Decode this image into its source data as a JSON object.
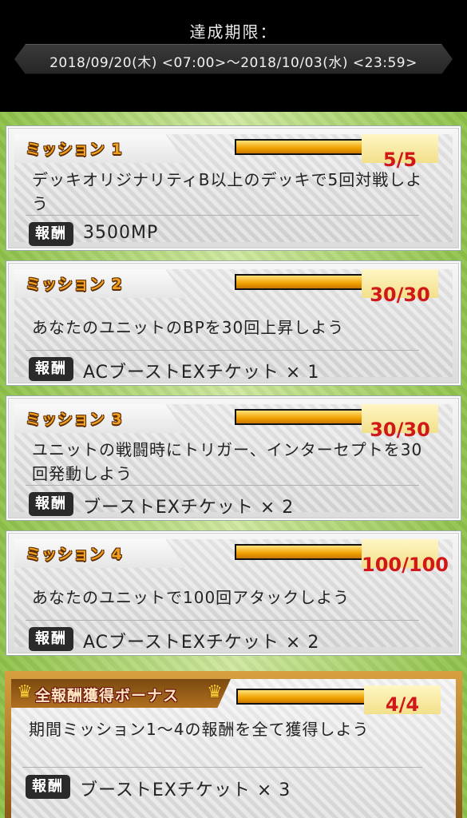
{
  "header": {
    "period_label": "達成期限：",
    "period_range": "2018/09/20(木) <07:00>〜2018/10/03(水) <23:59>"
  },
  "reward_label": "報酬",
  "missions": [
    {
      "title": "ミッション 1",
      "progress": 1.0,
      "count": "5/5",
      "description": "デッキオリジナリティB以上のデッキで5回対戦しよう",
      "reward": "3500MP"
    },
    {
      "title": "ミッション 2",
      "progress": 1.0,
      "count": "30/30",
      "description": "あなたのユニットのBPを30回上昇しよう",
      "reward": "ACブーストEXチケット × 1"
    },
    {
      "title": "ミッション 3",
      "progress": 1.0,
      "count": "30/30",
      "description": "ユニットの戦闘時にトリガー、インターセプトを30回発動しよう",
      "reward": "ブーストEXチケット × 2"
    },
    {
      "title": "ミッション 4",
      "progress": 1.0,
      "count": "100/100",
      "description": "あなたのユニットで100回アタックしよう",
      "reward": "ACブーストEXチケット × 2"
    }
  ],
  "bonus": {
    "title": "全報酬獲得ボーナス",
    "progress": 1.0,
    "count": "4/4",
    "description": "期間ミッション1〜4の報酬を全て獲得しよう",
    "reward": "ブーストEXチケット × 3"
  },
  "colors": {
    "count_red": "#d01818",
    "title_orange": "#f0a020",
    "backdrop_green": "#8fc24a"
  }
}
